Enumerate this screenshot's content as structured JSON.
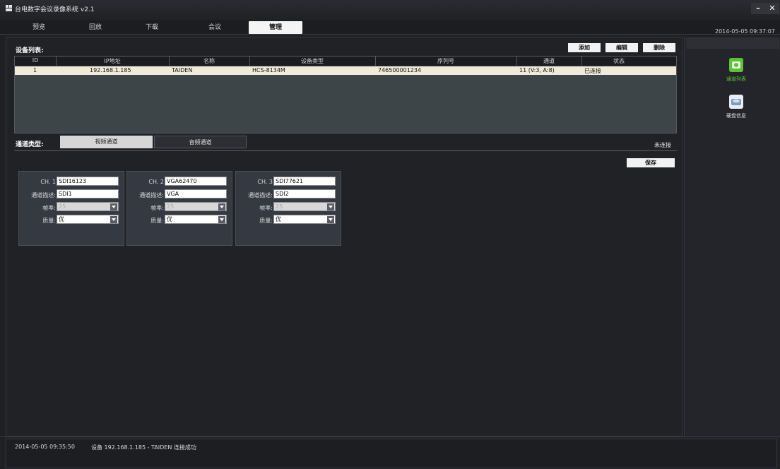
{
  "app": {
    "title": "台电数字会议录像系统 v2.1"
  },
  "tabs": [
    {
      "label": "预览"
    },
    {
      "label": "回放"
    },
    {
      "label": "下载"
    },
    {
      "label": "会议"
    },
    {
      "label": "管理",
      "active": true
    }
  ],
  "clock": "2014-05-05 09:37:07",
  "device_list": {
    "label": "设备列表:",
    "buttons": {
      "add": "添加",
      "edit": "编辑",
      "delete": "删除"
    },
    "columns": [
      "ID",
      "IP地址",
      "名称",
      "设备类型",
      "序列号",
      "通道",
      "状态"
    ],
    "rows": [
      {
        "id": "1",
        "ip": "192.168.1.185",
        "name": "TAIDEN",
        "type": "HCS-8134M",
        "serial": "746500001234",
        "channel": "11 (V:3, A:8)",
        "status": "已连接"
      }
    ]
  },
  "channel_type": {
    "label": "通道类型:",
    "video_tab": "视频通道",
    "audio_tab": "音频通道",
    "status": "未连接",
    "save": "保存"
  },
  "channels": [
    {
      "ch_label": "CH. 1",
      "ch_value": "SDI16123",
      "desc_label": "通道描述:",
      "desc_value": "SDI1",
      "fps_label": "帧率:",
      "fps_value": "25",
      "quality_label": "质量:",
      "quality_value": "优"
    },
    {
      "ch_label": "CH. 2",
      "ch_value": "VGA62470",
      "desc_label": "通道描述:",
      "desc_value": "VGA",
      "fps_label": "帧率:",
      "fps_value": "25",
      "quality_label": "质量:",
      "quality_value": "优"
    },
    {
      "ch_label": "CH. 3",
      "ch_value": "SDI77621",
      "desc_label": "通道描述:",
      "desc_value": "SDI2",
      "fps_label": "帧率:",
      "fps_value": "25",
      "quality_label": "质量:",
      "quality_value": "优"
    }
  ],
  "sidebar": {
    "items": [
      {
        "label": "通道列表",
        "icon": "channel-list-icon",
        "active": true
      },
      {
        "label": "硬盘信息",
        "icon": "disk-icon"
      }
    ]
  },
  "log": {
    "time": "2014-05-05 09:35:50",
    "message": "设备 192.168.1.185 - TAIDEN 连接成功"
  },
  "colors": {
    "accent_green": "#5fc234",
    "row_highlight": "#efebd8",
    "background": "#1f2024"
  }
}
